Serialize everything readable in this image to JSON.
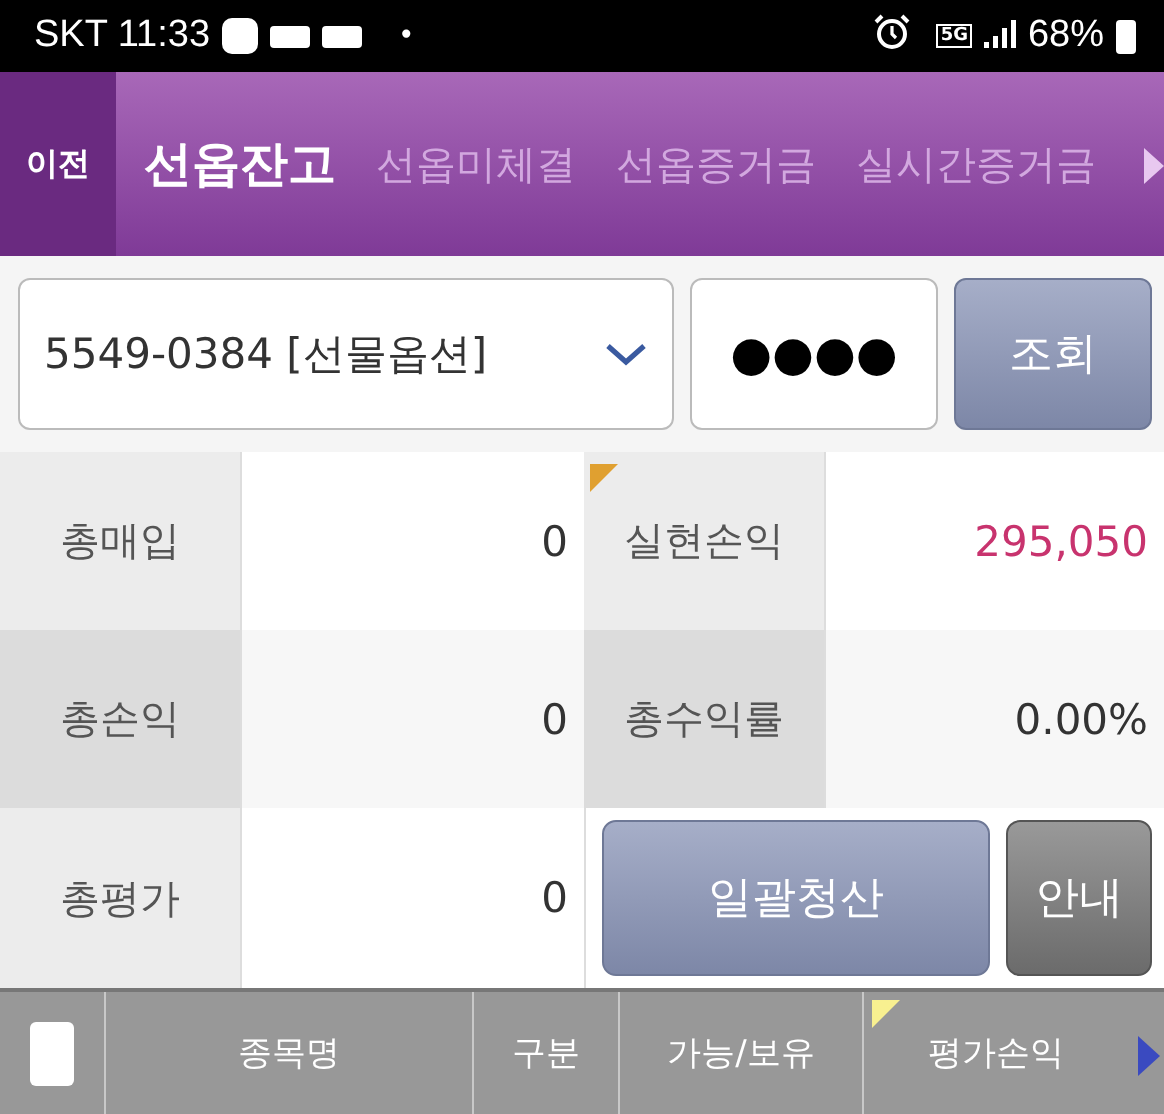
{
  "status_bar": {
    "carrier_time": "SKT 11:33",
    "dot": "•",
    "network": "5G",
    "battery": "68%"
  },
  "header": {
    "back": "이전",
    "tabs": [
      {
        "label": "선옵잔고",
        "selected": true
      },
      {
        "label": "선옵미체결",
        "selected": false
      },
      {
        "label": "선옵증거금",
        "selected": false
      },
      {
        "label": "실시간증거금",
        "selected": false
      }
    ]
  },
  "query": {
    "account": "5549-0384 [선물옵션]",
    "password": "●●●●",
    "button": "조회"
  },
  "summary": [
    {
      "label": "총매입",
      "value": "0",
      "color": "#333333",
      "flag": false
    },
    {
      "label": "실현손익",
      "value": "295,050",
      "color": "#c8336e",
      "flag": true
    },
    {
      "label": "총손익",
      "value": "0",
      "color": "#333333",
      "flag": false
    },
    {
      "label": "총수익률",
      "value": "0.00%",
      "color": "#333333",
      "flag": false
    }
  ],
  "total": {
    "label": "총평가",
    "value": "0"
  },
  "actions": [
    "일괄청산",
    "안내"
  ],
  "table": {
    "select_all": {
      "checked": false
    },
    "columns": [
      {
        "label": "종목명",
        "flag": false
      },
      {
        "label": "구분",
        "flag": false
      },
      {
        "label": "가능/보유",
        "flag": false
      },
      {
        "label": "평가손익",
        "flag": true
      }
    ]
  }
}
